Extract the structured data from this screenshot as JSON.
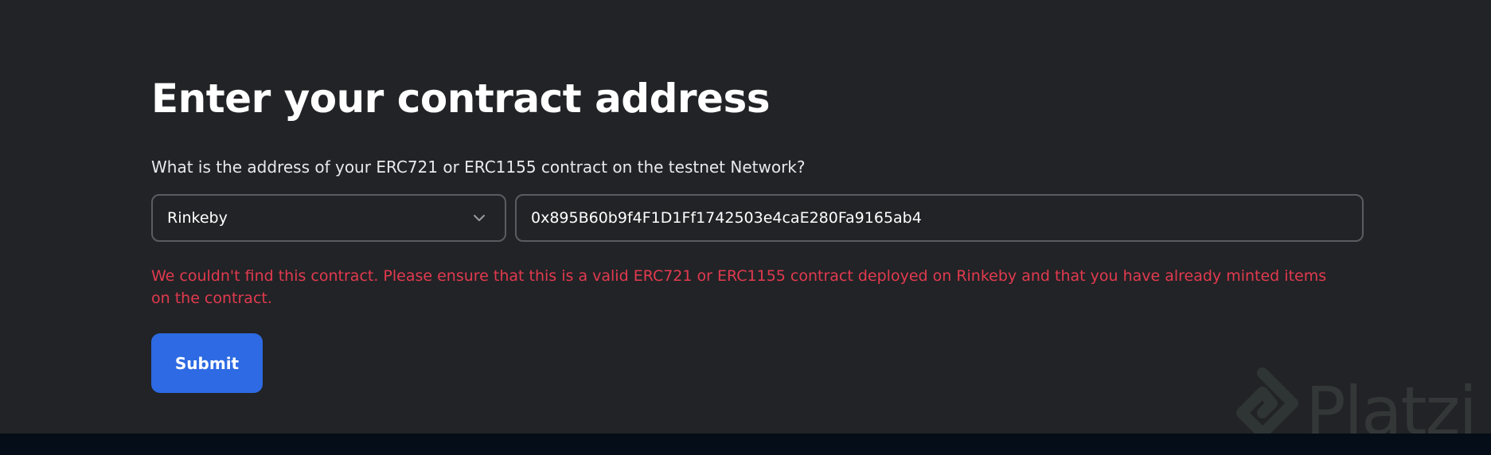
{
  "page": {
    "title": "Enter your contract address",
    "question": "What is the address of your ERC721 or ERC1155 contract on the testnet Network?"
  },
  "network_select": {
    "selected": "Rinkeby",
    "icon": "chevron-down-icon"
  },
  "address_input": {
    "value": "0x895B60b9f4F1D1Ff1742503e4caE280Fa9165ab4"
  },
  "error_message": "We couldn't find this contract. Please ensure that this is a valid ERC721 or ERC1155 contract deployed on Rinkeby and that you have already minted items on the contract.",
  "submit_label": "Submit",
  "watermark": {
    "brand": "Platzi",
    "icon": "platzi-logo-icon"
  },
  "colors": {
    "background": "#222326",
    "accent": "#2d6ae3",
    "error": "#e23a4f",
    "border": "#5b5c61",
    "bottom_bar": "#040d18"
  }
}
